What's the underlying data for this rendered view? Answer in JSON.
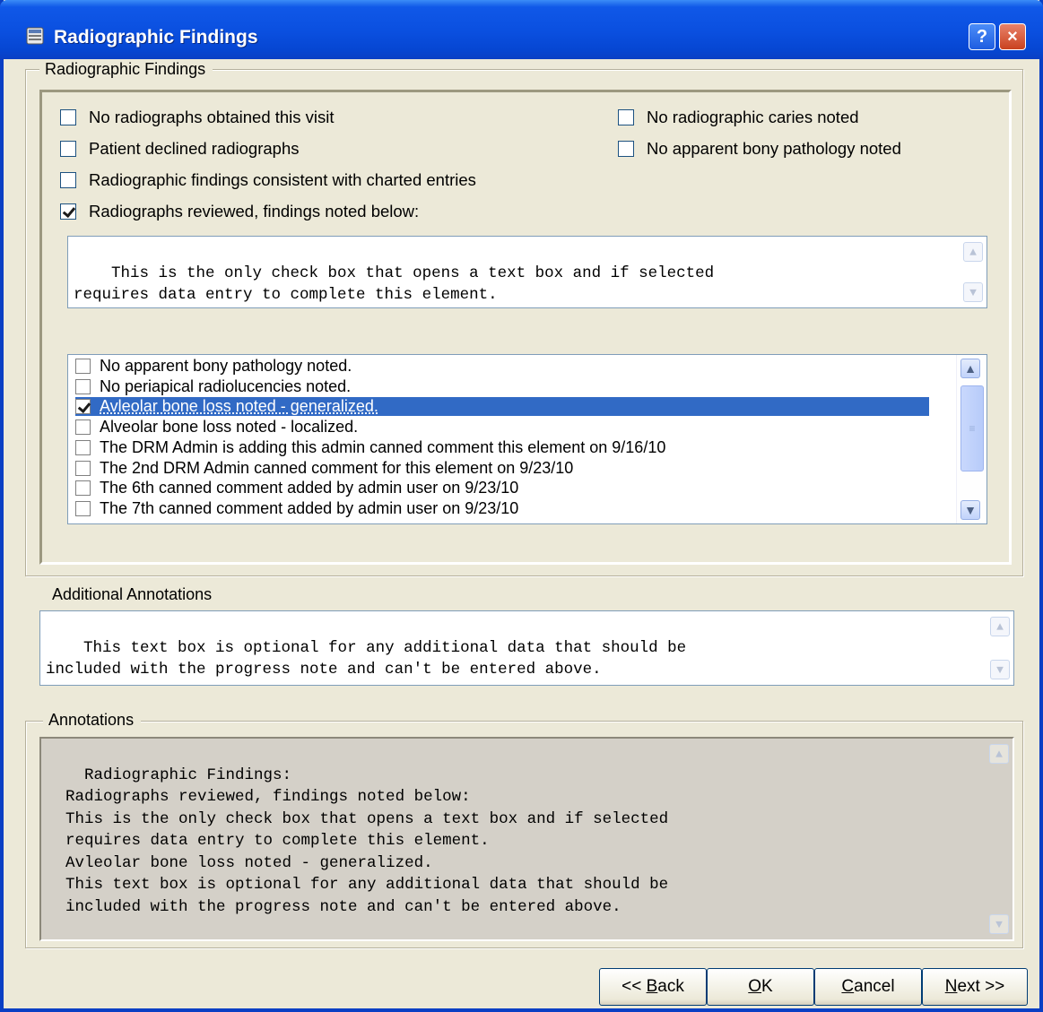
{
  "window": {
    "title": "Radiographic Findings",
    "help_label": "?",
    "close_label": "×"
  },
  "group_main": {
    "legend": "Radiographic Findings",
    "checkboxes_left": [
      {
        "label": "No radiographs obtained this visit",
        "checked": false
      },
      {
        "label": "Patient declined radiographs",
        "checked": false
      },
      {
        "label": "Radiographic findings consistent with charted entries",
        "checked": false
      },
      {
        "label": "Radiographs reviewed, findings noted below:",
        "checked": true
      }
    ],
    "checkboxes_right": [
      {
        "label": "No radiographic caries noted",
        "checked": false
      },
      {
        "label": "No apparent bony pathology noted",
        "checked": false
      }
    ],
    "findings_text": "This is the only check box that opens a text box and if selected\nrequires data entry to complete this element.",
    "list_items": [
      {
        "label": "No apparent bony pathology noted.",
        "checked": false,
        "selected": false
      },
      {
        "label": "No periapical radiolucencies noted.",
        "checked": false,
        "selected": false
      },
      {
        "label": "Avleolar bone loss noted - generalized.",
        "checked": true,
        "selected": true
      },
      {
        "label": "Alveolar bone loss noted - localized.",
        "checked": false,
        "selected": false
      },
      {
        "label": "The DRM Admin is adding this admin canned comment this element on 9/16/10",
        "checked": false,
        "selected": false
      },
      {
        "label": "The 2nd DRM Admin canned comment for this element on 9/23/10",
        "checked": false,
        "selected": false
      },
      {
        "label": "The 6th canned comment added by admin user on 9/23/10",
        "checked": false,
        "selected": false
      },
      {
        "label": "The 7th canned comment added by admin user on 9/23/10",
        "checked": false,
        "selected": false
      }
    ]
  },
  "additional": {
    "legend": "Additional Annotations",
    "text": "This text box is optional for any additional data that should be\nincluded with the progress note and can't be entered above."
  },
  "annotations": {
    "legend": "Annotations",
    "text": "Radiographic Findings:\n  Radiographs reviewed, findings noted below:\n  This is the only check box that opens a text box and if selected\n  requires data entry to complete this element.\n  Avleolar bone loss noted - generalized.\n  This text box is optional for any additional data that should be\n  included with the progress note and can't be entered above."
  },
  "buttons": {
    "back": {
      "prefix": "<< ",
      "mnemonic": "B",
      "rest": "ack"
    },
    "ok": {
      "prefix": "",
      "mnemonic": "O",
      "rest": "K"
    },
    "cancel": {
      "prefix": "",
      "mnemonic": "C",
      "rest": "ancel"
    },
    "next": {
      "prefix": "",
      "mnemonic": "N",
      "rest": "ext >>"
    }
  }
}
